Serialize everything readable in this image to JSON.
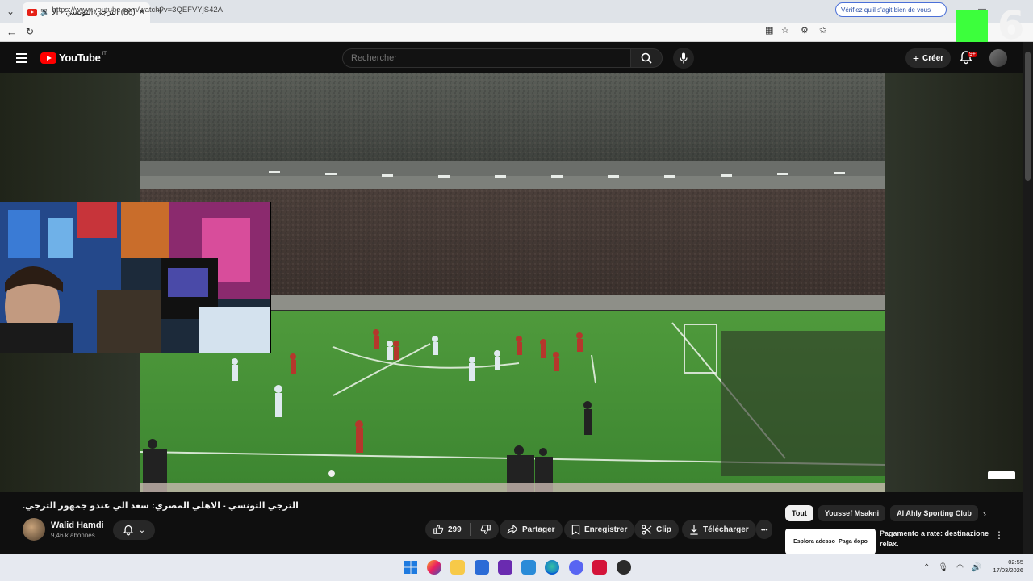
{
  "browser": {
    "tab_title": "(86) الترجي التونسي - الاهلي الم...",
    "url": "https://www.youtube.com/watch?v=3QEFVYjS42A",
    "verify_text": "Vérifiez qu'il s'agit bien de vous",
    "new_tab_label": "+",
    "overlay_logo_number": "6"
  },
  "header": {
    "logo_text": "YouTube",
    "logo_country": "IT",
    "search_placeholder": "Rechercher",
    "create_label": "Créer",
    "notification_badge": "9+"
  },
  "video": {
    "title": "الترجي التونسي - الاهلي المصري: سعد الي عندو جمهور الترجي.",
    "channel_name": "Walid Hamdi",
    "channel_subscribers": "9,46 k abonnés",
    "likes": "299",
    "actions": {
      "share": "Partager",
      "save": "Enregistrer",
      "clip": "Clip",
      "download": "Télécharger",
      "more": "•••"
    }
  },
  "sidebar": {
    "chips": [
      "Tout",
      "Youssef Msakni",
      "Al Ahly Sporting Club"
    ],
    "ad": {
      "thumb_left": "Esplora adesso",
      "thumb_right": "Paga dopo",
      "title": "Pagamento a rate: destinazione relax."
    }
  },
  "taskbar": {
    "time": "02:55",
    "date": "17/03/2026"
  },
  "colors": {
    "youtube_red": "#ff0000",
    "background": "#0f0f0f",
    "pill": "#272727",
    "overlay_green": "#3cff3c"
  }
}
